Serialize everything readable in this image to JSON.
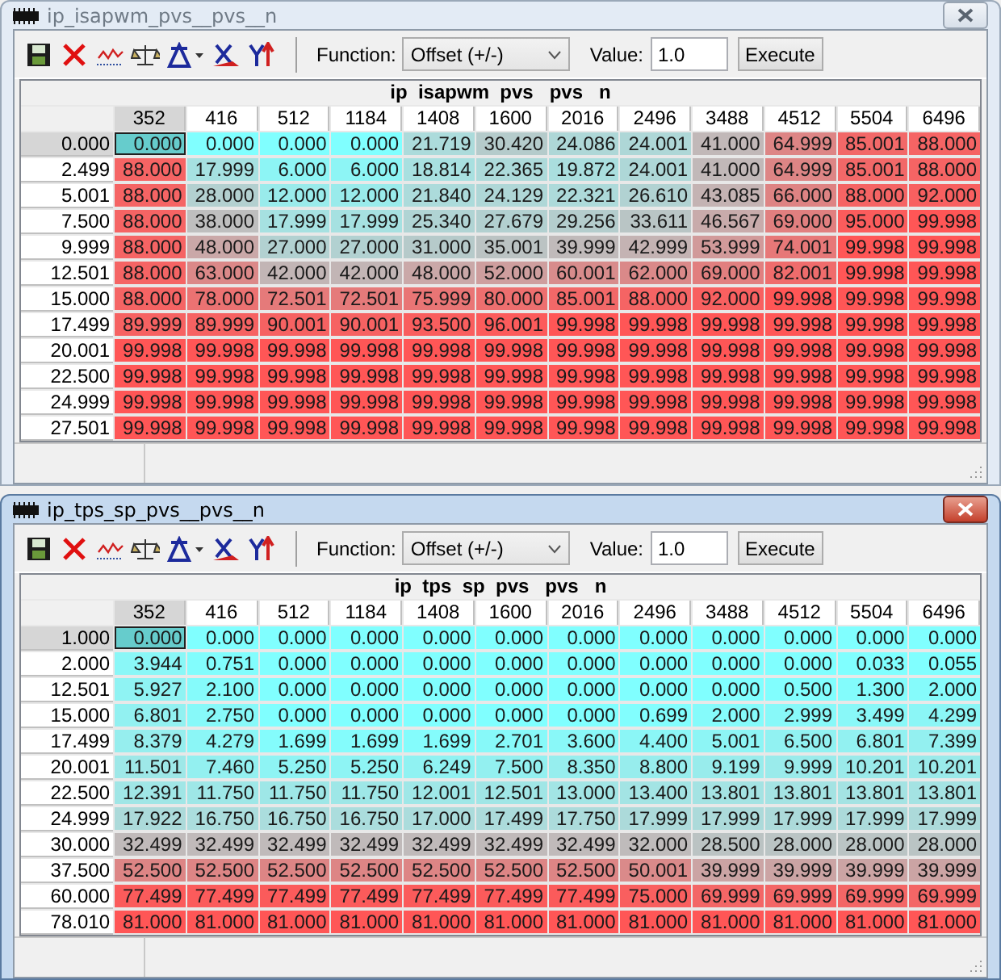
{
  "windows": [
    {
      "title": "ip_isapwm_pvs__pvs__n",
      "active": false,
      "toolbar": {
        "function_label": "Function:",
        "function_value": "Offset (+/-)",
        "value_label": "Value:",
        "value": "1.0",
        "execute": "Execute"
      },
      "table": {
        "caption": "ip  isapwm  pvs   pvs   n",
        "columns": [
          {
            "label": "352",
            "selected": true
          },
          {
            "label": "416",
            "selected": false
          },
          {
            "label": "512",
            "selected": false
          },
          {
            "label": "1184",
            "selected": false
          },
          {
            "label": "1408",
            "selected": false
          },
          {
            "label": "1600",
            "selected": false
          },
          {
            "label": "2016",
            "selected": false
          },
          {
            "label": "2496",
            "selected": false
          },
          {
            "label": "3488",
            "selected": false
          },
          {
            "label": "4512",
            "selected": false
          },
          {
            "label": "5504",
            "selected": false
          },
          {
            "label": "6496",
            "selected": false
          }
        ],
        "rows": [
          {
            "label": "0.000",
            "selected": true,
            "cells": [
              "0.000",
              "0.000",
              "0.000",
              "0.000",
              "21.719",
              "30.420",
              "24.086",
              "24.001",
              "41.000",
              "64.999",
              "85.001",
              "88.000"
            ]
          },
          {
            "label": "2.499",
            "selected": false,
            "cells": [
              "88.000",
              "17.999",
              "6.000",
              "6.000",
              "18.814",
              "22.365",
              "19.872",
              "24.001",
              "41.000",
              "64.999",
              "85.001",
              "88.000"
            ]
          },
          {
            "label": "5.001",
            "selected": false,
            "cells": [
              "88.000",
              "28.000",
              "12.000",
              "12.000",
              "21.840",
              "24.129",
              "22.321",
              "26.610",
              "43.085",
              "66.000",
              "88.000",
              "92.000"
            ]
          },
          {
            "label": "7.500",
            "selected": false,
            "cells": [
              "88.000",
              "38.000",
              "17.999",
              "17.999",
              "25.340",
              "27.679",
              "29.256",
              "33.611",
              "46.567",
              "69.000",
              "95.000",
              "99.998"
            ]
          },
          {
            "label": "9.999",
            "selected": false,
            "cells": [
              "88.000",
              "48.000",
              "27.000",
              "27.000",
              "31.000",
              "35.001",
              "39.999",
              "42.999",
              "53.999",
              "74.001",
              "99.998",
              "99.998"
            ]
          },
          {
            "label": "12.501",
            "selected": false,
            "cells": [
              "88.000",
              "63.000",
              "42.000",
              "42.000",
              "48.000",
              "52.000",
              "60.001",
              "62.000",
              "69.000",
              "82.001",
              "99.998",
              "99.998"
            ]
          },
          {
            "label": "15.000",
            "selected": false,
            "cells": [
              "88.000",
              "78.000",
              "72.501",
              "72.501",
              "75.999",
              "80.000",
              "85.001",
              "88.000",
              "92.000",
              "99.998",
              "99.998",
              "99.998"
            ]
          },
          {
            "label": "17.499",
            "selected": false,
            "cells": [
              "89.999",
              "89.999",
              "90.001",
              "90.001",
              "93.500",
              "96.001",
              "99.998",
              "99.998",
              "99.998",
              "99.998",
              "99.998",
              "99.998"
            ]
          },
          {
            "label": "20.001",
            "selected": false,
            "cells": [
              "99.998",
              "99.998",
              "99.998",
              "99.998",
              "99.998",
              "99.998",
              "99.998",
              "99.998",
              "99.998",
              "99.998",
              "99.998",
              "99.998"
            ]
          },
          {
            "label": "22.500",
            "selected": false,
            "cells": [
              "99.998",
              "99.998",
              "99.998",
              "99.998",
              "99.998",
              "99.998",
              "99.998",
              "99.998",
              "99.998",
              "99.998",
              "99.998",
              "99.998"
            ]
          },
          {
            "label": "24.999",
            "selected": false,
            "cells": [
              "99.998",
              "99.998",
              "99.998",
              "99.998",
              "99.998",
              "99.998",
              "99.998",
              "99.998",
              "99.998",
              "99.998",
              "99.998",
              "99.998"
            ]
          },
          {
            "label": "27.501",
            "selected": false,
            "cells": [
              "99.998",
              "99.998",
              "99.998",
              "99.998",
              "99.998",
              "99.998",
              "99.998",
              "99.998",
              "99.998",
              "99.998",
              "99.998",
              "99.998"
            ]
          }
        ]
      }
    },
    {
      "title": "ip_tps_sp_pvs__pvs__n",
      "active": true,
      "toolbar": {
        "function_label": "Function:",
        "function_value": "Offset (+/-)",
        "value_label": "Value:",
        "value": "1.0",
        "execute": "Execute"
      },
      "table": {
        "caption": "ip  tps  sp  pvs   pvs   n",
        "columns": [
          {
            "label": "352",
            "selected": true
          },
          {
            "label": "416",
            "selected": false
          },
          {
            "label": "512",
            "selected": false
          },
          {
            "label": "1184",
            "selected": false
          },
          {
            "label": "1408",
            "selected": false
          },
          {
            "label": "1600",
            "selected": false
          },
          {
            "label": "2016",
            "selected": false
          },
          {
            "label": "2496",
            "selected": false
          },
          {
            "label": "3488",
            "selected": false
          },
          {
            "label": "4512",
            "selected": false
          },
          {
            "label": "5504",
            "selected": false
          },
          {
            "label": "6496",
            "selected": false
          }
        ],
        "rows": [
          {
            "label": "1.000",
            "selected": true,
            "cells": [
              "0.000",
              "0.000",
              "0.000",
              "0.000",
              "0.000",
              "0.000",
              "0.000",
              "0.000",
              "0.000",
              "0.000",
              "0.000",
              "0.000"
            ]
          },
          {
            "label": "2.000",
            "selected": false,
            "cells": [
              "3.944",
              "0.751",
              "0.000",
              "0.000",
              "0.000",
              "0.000",
              "0.000",
              "0.000",
              "0.000",
              "0.000",
              "0.033",
              "0.055"
            ]
          },
          {
            "label": "12.501",
            "selected": false,
            "cells": [
              "5.927",
              "2.100",
              "0.000",
              "0.000",
              "0.000",
              "0.000",
              "0.000",
              "0.000",
              "0.000",
              "0.500",
              "1.300",
              "2.000"
            ]
          },
          {
            "label": "15.000",
            "selected": false,
            "cells": [
              "6.801",
              "2.750",
              "0.000",
              "0.000",
              "0.000",
              "0.000",
              "0.000",
              "0.699",
              "2.000",
              "2.999",
              "3.499",
              "4.299"
            ]
          },
          {
            "label": "17.499",
            "selected": false,
            "cells": [
              "8.379",
              "4.279",
              "1.699",
              "1.699",
              "1.699",
              "2.701",
              "3.600",
              "4.400",
              "5.001",
              "6.500",
              "6.801",
              "7.399"
            ]
          },
          {
            "label": "20.001",
            "selected": false,
            "cells": [
              "11.501",
              "7.460",
              "5.250",
              "5.250",
              "6.249",
              "7.500",
              "8.350",
              "8.800",
              "9.199",
              "9.999",
              "10.201",
              "10.201"
            ]
          },
          {
            "label": "22.500",
            "selected": false,
            "cells": [
              "12.391",
              "11.750",
              "11.750",
              "11.750",
              "12.001",
              "12.501",
              "13.000",
              "13.400",
              "13.801",
              "13.801",
              "13.801",
              "13.801"
            ]
          },
          {
            "label": "24.999",
            "selected": false,
            "cells": [
              "17.922",
              "16.750",
              "16.750",
              "16.750",
              "17.000",
              "17.499",
              "17.750",
              "17.999",
              "17.999",
              "17.999",
              "17.999",
              "17.999"
            ]
          },
          {
            "label": "30.000",
            "selected": false,
            "cells": [
              "32.499",
              "32.499",
              "32.499",
              "32.499",
              "32.499",
              "32.499",
              "32.499",
              "32.000",
              "28.500",
              "28.000",
              "28.000",
              "28.000"
            ]
          },
          {
            "label": "37.500",
            "selected": false,
            "cells": [
              "52.500",
              "52.500",
              "52.500",
              "52.500",
              "52.500",
              "52.500",
              "52.500",
              "50.001",
              "39.999",
              "39.999",
              "39.999",
              "39.999"
            ]
          },
          {
            "label": "60.000",
            "selected": false,
            "cells": [
              "77.499",
              "77.499",
              "77.499",
              "77.499",
              "77.499",
              "77.499",
              "77.499",
              "75.000",
              "69.999",
              "69.999",
              "69.999",
              "69.999"
            ]
          },
          {
            "label": "78.010",
            "selected": false,
            "cells": [
              "81.000",
              "81.000",
              "81.000",
              "81.000",
              "81.000",
              "81.000",
              "81.000",
              "81.000",
              "81.000",
              "81.000",
              "81.000",
              "81.000"
            ]
          }
        ]
      }
    }
  ]
}
